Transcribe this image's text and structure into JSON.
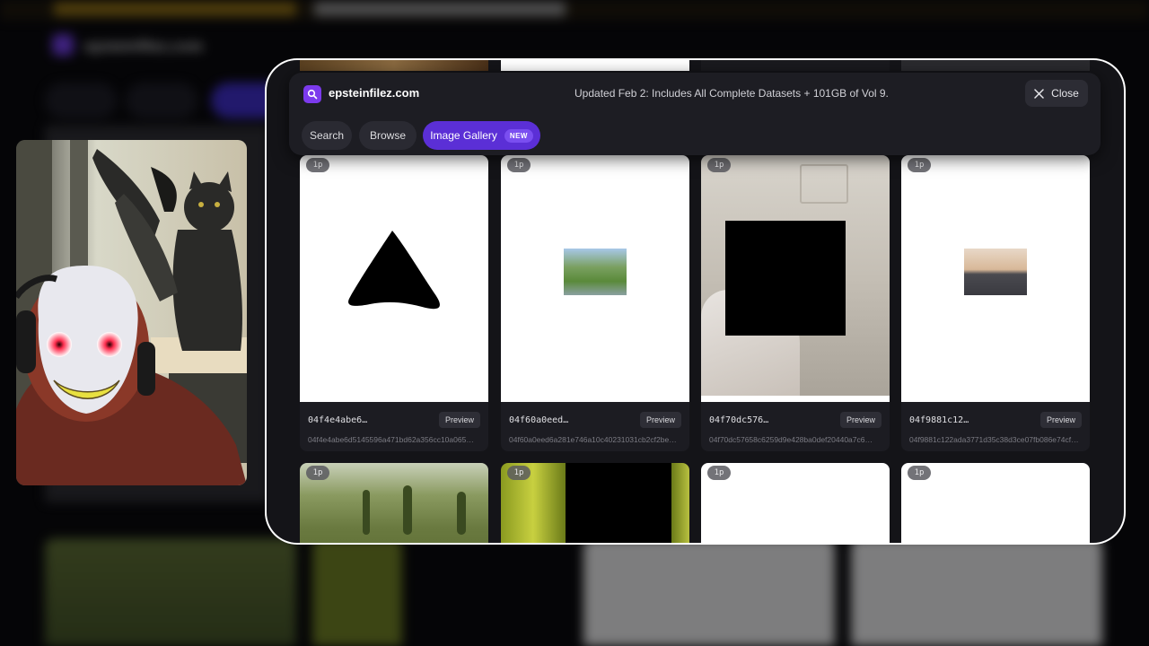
{
  "background": {
    "site_name": "epsteinfilez.com"
  },
  "header": {
    "site_name": "epsteinfilez.com",
    "announcement": "Updated Feb 2: Includes All Complete Datasets + 101GB of Vol 9.",
    "close_label": "Close",
    "icons": [
      "search-icon",
      "close-icon"
    ]
  },
  "tabs": [
    {
      "label": "Search"
    },
    {
      "label": "Browse"
    },
    {
      "label": "Image Gallery",
      "badge": "NEW",
      "active": true
    }
  ],
  "gallery": {
    "preview_label": "Preview",
    "items": [
      {
        "pages": "1p",
        "id": "04f4e4abe6…",
        "hash": "04f4e4abe6d5145596a471bd62a356cc10a065…"
      },
      {
        "pages": "1p",
        "id": "04f60a0eed…",
        "hash": "04f60a0eed6a281e746a10c40231031cb2cf2be…"
      },
      {
        "pages": "1p",
        "id": "04f70dc576…",
        "hash": "04f70dc57658c6259d9e428ba0def20440a7c6…"
      },
      {
        "pages": "1p",
        "id": "04f9881c12…",
        "hash": "04f9881c122ada3771d35c38d3ce07fb086e74cf…"
      },
      {
        "pages": "1p"
      },
      {
        "pages": "1p"
      },
      {
        "pages": "1p"
      },
      {
        "pages": "1p"
      }
    ]
  },
  "colors": {
    "accent": "#5b2fd6",
    "badge": "#7a4ef0",
    "modal_bg": "#141418",
    "logo": "#7c3aed"
  }
}
